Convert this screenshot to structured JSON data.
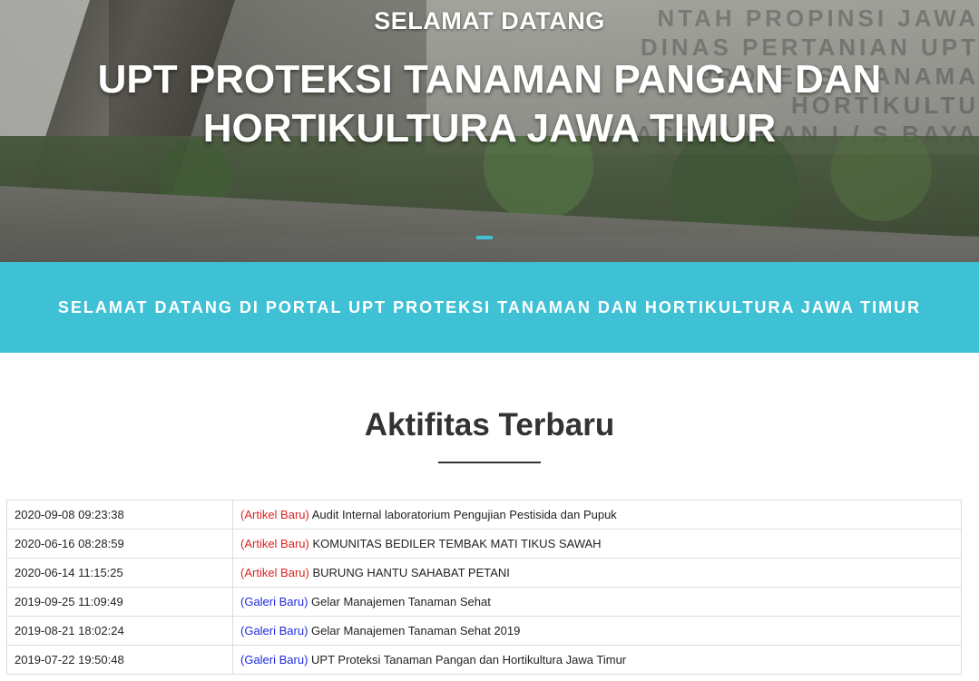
{
  "hero": {
    "kicker": "SELAMAT DATANG",
    "title": "UPT PROTEKSI TANAMAN PANGAN DAN HORTIKULTURA JAWA TIMUR",
    "background_sign_text": "NTAH PROPINSI JAWA DINAS PERTANIAN UPT PROTEKSI TANAMA HORTIKULTU PACEBANGAN I / S BAYA"
  },
  "banner": {
    "text": "SELAMAT DATANG DI PORTAL UPT PROTEKSI TANAMAN DAN HORTIKULTURA JAWA TIMUR",
    "color": "#3ec1d5"
  },
  "activities": {
    "heading": "Aktifitas Terbaru",
    "rows": [
      {
        "date": "2020-09-08 09:23:38",
        "tag": "(Artikel Baru)",
        "type": "artikel",
        "title": "Audit Internal laboratorium Pengujian Pestisida dan Pupuk"
      },
      {
        "date": "2020-06-16 08:28:59",
        "tag": "(Artikel Baru)",
        "type": "artikel",
        "title": "KOMUNITAS BEDILER TEMBAK MATI TIKUS SAWAH"
      },
      {
        "date": "2020-06-14 11:15:25",
        "tag": "(Artikel Baru)",
        "type": "artikel",
        "title": "BURUNG HANTU SAHABAT PETANI"
      },
      {
        "date": "2019-09-25 11:09:49",
        "tag": "(Galeri Baru)",
        "type": "galeri",
        "title": "Gelar Manajemen Tanaman Sehat"
      },
      {
        "date": "2019-08-21 18:02:24",
        "tag": "(Galeri Baru)",
        "type": "galeri",
        "title": "Gelar Manajemen Tanaman Sehat 2019"
      },
      {
        "date": "2019-07-22 19:50:48",
        "tag": "(Galeri Baru)",
        "type": "galeri",
        "title": "UPT Proteksi Tanaman Pangan dan Hortikultura Jawa Timur"
      }
    ]
  },
  "colors": {
    "artikel_tag": "#e02020",
    "galeri_tag": "#1f2be0"
  }
}
